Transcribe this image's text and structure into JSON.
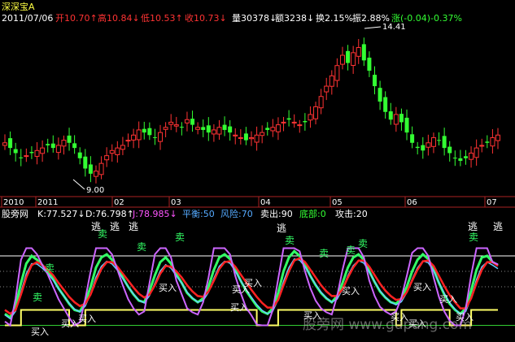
{
  "stock_name": "深深宝A",
  "date": "2011/07/06",
  "quote": [
    {
      "label": "开",
      "value": "10.70",
      "arrow": "↑",
      "color": "#ff3333"
    },
    {
      "label": "高",
      "value": "10.84",
      "arrow": "↓",
      "color": "#ff3333"
    },
    {
      "label": "低",
      "value": "10.53",
      "arrow": "↑",
      "color": "#ff3333"
    },
    {
      "label": "收",
      "value": "10.73",
      "arrow": "↓",
      "color": "#ff3333"
    },
    {
      "label": "量",
      "value": "30378",
      "arrow": "↓",
      "color": "#ffffff"
    },
    {
      "label": "额",
      "value": "3238",
      "arrow": "↓",
      "color": "#ffffff"
    },
    {
      "label": "换",
      "value": "2.15%",
      "arrow": "",
      "color": "#ffffff"
    },
    {
      "label": "振",
      "value": "2.88%",
      "arrow": "",
      "color": "#ffffff"
    },
    {
      "label": "涨",
      "value": "(-0.04)-0.37%",
      "arrow": "",
      "color": "#33ff33"
    }
  ],
  "price_marks": {
    "high": "14.41",
    "low": "9.00"
  },
  "time_labels": [
    "2010",
    "2011",
    "02",
    "03",
    "04",
    "05",
    "06",
    "07"
  ],
  "indicator": {
    "name": "股旁网",
    "items": [
      {
        "label": "K:",
        "value": "77.527",
        "arrow": "↓",
        "color": "#ffffff"
      },
      {
        "label": "D:",
        "value": "76.798",
        "arrow": "↑",
        "color": "#ffffff"
      },
      {
        "label": "J:",
        "value": "78.985",
        "arrow": "↓",
        "color": "#ff55ff"
      },
      {
        "label": "平衡:",
        "value": "50",
        "arrow": "",
        "color": "#55aaff"
      },
      {
        "label": "风险:",
        "value": "70",
        "arrow": "",
        "color": "#55aaff"
      },
      {
        "label": "卖出:",
        "value": "90",
        "arrow": "",
        "color": "#ffffff"
      },
      {
        "label": "底部:",
        "value": "0",
        "arrow": "",
        "color": "#33ff33"
      },
      {
        "label": "攻击:",
        "value": "20",
        "arrow": "",
        "color": "#ffffff"
      }
    ]
  },
  "signal_labels": {
    "buy": "买入",
    "sell": "卖",
    "escape": "逃"
  },
  "watermark": "股旁网 www.gupang.com",
  "colors": {
    "up": "#ff3333",
    "down": "#33ff33",
    "grid": "#8a1a1a",
    "k_line": "#33ff66",
    "d_line": "#ff2222",
    "j_line": "#cc66ff",
    "cyan_line": "#66ccff",
    "yellow_line": "#ffff66"
  },
  "chart_data": [
    {
      "type": "candlestick",
      "title": "深深宝A",
      "x_labels": [
        "2010",
        "2011",
        "02",
        "03",
        "04",
        "05",
        "06",
        "07"
      ],
      "ylim": [
        8.5,
        15.0
      ],
      "close_series": [
        10.4,
        10.2,
        10.0,
        9.8,
        9.9,
        10.0,
        10.1,
        10.2,
        10.3,
        10.2,
        10.3,
        10.5,
        10.4,
        10.2,
        9.8,
        9.4,
        9.2,
        9.3,
        9.6,
        9.9,
        10.1,
        10.2,
        10.3,
        10.5,
        10.7,
        10.9,
        10.8,
        10.7,
        10.6,
        10.8,
        11.0,
        11.2,
        11.1,
        11.0,
        11.3,
        11.1,
        11.0,
        10.9,
        10.8,
        10.9,
        11.0,
        10.9,
        10.8,
        10.7,
        10.6,
        10.5,
        10.6,
        10.7,
        10.8,
        10.9,
        11.0,
        11.1,
        11.2,
        11.3,
        11.2,
        11.1,
        11.2,
        11.5,
        11.8,
        12.2,
        12.6,
        13.0,
        13.4,
        13.8,
        13.5,
        13.9,
        14.1,
        13.6,
        13.2,
        12.6,
        12.0,
        11.6,
        11.3,
        11.5,
        11.2,
        10.8,
        10.4,
        10.2,
        10.1,
        10.4,
        10.6,
        10.5,
        10.2,
        10.0,
        9.8,
        9.7,
        9.8,
        10.0,
        10.2,
        10.3,
        10.4,
        10.6,
        10.7
      ],
      "high": 14.41,
      "low": 9.0
    },
    {
      "type": "line",
      "title": "股旁网",
      "ylim": [
        -10,
        110
      ],
      "levels": {
        "卖出": 90,
        "风险": 70,
        "平衡": 50,
        "攻击": 20,
        "底部": 0
      },
      "series": [
        {
          "name": "K",
          "values": [
            15,
            10,
            25,
            55,
            80,
            90,
            85,
            78,
            70,
            60,
            48,
            38,
            28,
            20,
            18,
            30,
            50,
            75,
            88,
            92,
            85,
            75,
            62,
            50,
            40,
            32,
            30,
            45,
            65,
            82,
            88,
            80,
            66,
            55,
            42,
            35,
            30,
            35,
            50,
            72,
            88,
            92,
            86,
            72,
            58,
            45,
            35,
            25,
            18,
            15,
            22,
            42,
            70,
            88,
            96,
            90,
            78,
            64,
            52,
            42,
            35,
            30,
            38,
            55,
            75,
            88,
            92,
            85,
            70,
            56,
            44,
            36,
            30,
            28,
            35,
            50,
            70,
            85,
            92,
            86,
            72,
            55,
            40,
            28,
            20,
            15,
            22,
            45,
            72,
            88,
            90,
            82,
            78
          ]
        },
        {
          "name": "D",
          "values": [
            20,
            15,
            20,
            40,
            62,
            78,
            82,
            78,
            72,
            65,
            55,
            46,
            37,
            30,
            25,
            28,
            40,
            58,
            73,
            82,
            82,
            76,
            67,
            58,
            49,
            41,
            36,
            40,
            52,
            67,
            77,
            76,
            70,
            62,
            52,
            44,
            38,
            37,
            44,
            58,
            73,
            82,
            83,
            76,
            66,
            56,
            46,
            37,
            29,
            23,
            23,
            33,
            52,
            70,
            84,
            87,
            82,
            72,
            62,
            52,
            44,
            38,
            38,
            47,
            62,
            75,
            84,
            84,
            76,
            65,
            54,
            45,
            38,
            33,
            34,
            43,
            58,
            72,
            83,
            84,
            77,
            64,
            51,
            39,
            30,
            22,
            22,
            35,
            55,
            72,
            82,
            82,
            77
          ]
        },
        {
          "name": "J",
          "values": [
            5,
            0,
            35,
            85,
            100,
            100,
            92,
            78,
            66,
            50,
            34,
            22,
            10,
            0,
            4,
            34,
            70,
            100,
            100,
            100,
            92,
            72,
            52,
            34,
            22,
            14,
            18,
            55,
            92,
            100,
            100,
            88,
            58,
            40,
            22,
            17,
            14,
            30,
            62,
            100,
            100,
            100,
            92,
            64,
            42,
            23,
            13,
            1,
            0,
            0,
            20,
            60,
            100,
            100,
            100,
            96,
            70,
            48,
            32,
            22,
            17,
            14,
            38,
            72,
            100,
            100,
            100,
            88,
            58,
            38,
            24,
            18,
            14,
            18,
            36,
            64,
            94,
            100,
            100,
            90,
            62,
            37,
            18,
            6,
            0,
            0,
            22,
            65,
            100,
            100,
            100,
            82,
            79
          ]
        }
      ]
    }
  ]
}
